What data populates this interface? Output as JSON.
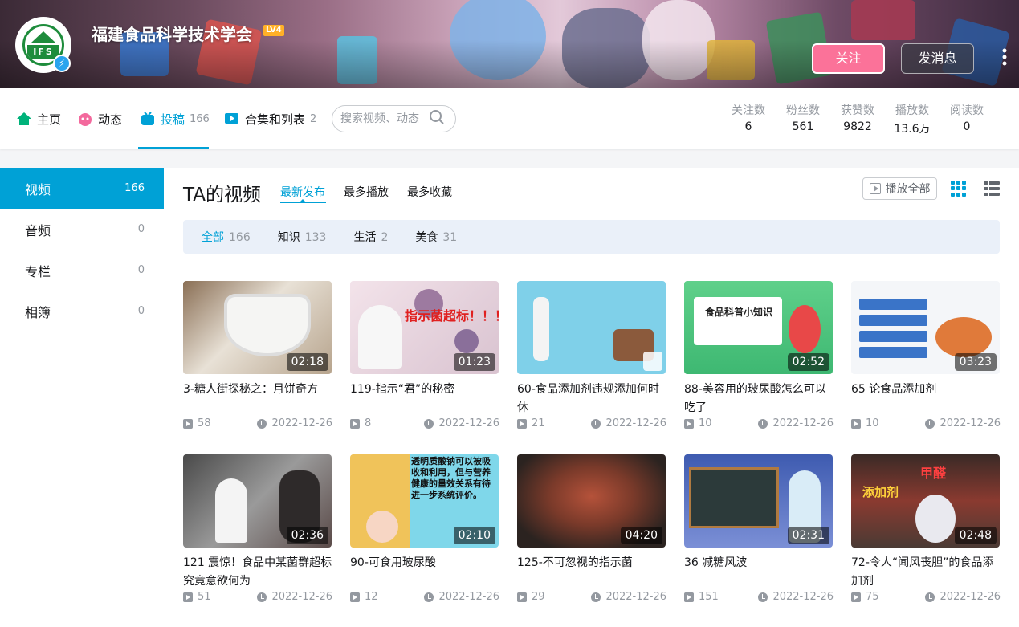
{
  "header": {
    "username": "福建食品科学技术学会",
    "level": "LV4",
    "avatar_text": "IFS",
    "follow_label": "关注",
    "message_label": "发消息",
    "more_label": "⋮"
  },
  "nav": {
    "items": [
      {
        "label": "主页",
        "count": ""
      },
      {
        "label": "动态",
        "count": ""
      },
      {
        "label": "投稿",
        "count": "166"
      },
      {
        "label": "合集和列表",
        "count": "2"
      }
    ],
    "search_placeholder": "搜索视频、动态"
  },
  "stats": [
    {
      "label": "关注数",
      "value": "6"
    },
    {
      "label": "粉丝数",
      "value": "561"
    },
    {
      "label": "获赞数",
      "value": "9822"
    },
    {
      "label": "播放数",
      "value": "13.6万"
    },
    {
      "label": "阅读数",
      "value": "0"
    }
  ],
  "sidebar": {
    "items": [
      {
        "label": "视频",
        "count": "166"
      },
      {
        "label": "音频",
        "count": "0"
      },
      {
        "label": "专栏",
        "count": "0"
      },
      {
        "label": "相簿",
        "count": "0"
      }
    ]
  },
  "main": {
    "title": "TA的视频",
    "sort": [
      "最新发布",
      "最多播放",
      "最多收藏"
    ],
    "play_all": "播放全部",
    "filters": [
      {
        "label": "全部",
        "count": "166"
      },
      {
        "label": "知识",
        "count": "133"
      },
      {
        "label": "生活",
        "count": "2"
      },
      {
        "label": "美食",
        "count": "31"
      }
    ]
  },
  "videos": [
    {
      "title": "3-糖人街探秘之：月饼奇方",
      "duration": "02:18",
      "plays": "58",
      "date": "2022-12-26"
    },
    {
      "title": "119-指示“君”的秘密",
      "duration": "01:23",
      "plays": "8",
      "date": "2022-12-26"
    },
    {
      "title": "60-食品添加剂违规添加何时休",
      "duration": "",
      "plays": "21",
      "date": "2022-12-26"
    },
    {
      "title": "88-美容用的玻尿酸怎么可以吃了",
      "duration": "02:52",
      "plays": "10",
      "date": "2022-12-26"
    },
    {
      "title": "65 论食品添加剂",
      "duration": "03:23",
      "plays": "10",
      "date": "2022-12-26"
    },
    {
      "title": "121 震惊！食品中某菌群超标究竟意欲何为",
      "duration": "02:36",
      "plays": "51",
      "date": "2022-12-26"
    },
    {
      "title": "90-可食用玻尿酸",
      "duration": "02:10",
      "plays": "12",
      "date": "2022-12-26"
    },
    {
      "title": "125-不可忽视的指示菌",
      "duration": "04:20",
      "plays": "29",
      "date": "2022-12-26"
    },
    {
      "title": "36 减糖风波",
      "duration": "02:31",
      "plays": "151",
      "date": "2022-12-26"
    },
    {
      "title": "72-令人“闻风丧胆”的食品添加剂",
      "duration": "02:48",
      "plays": "75",
      "date": "2022-12-26"
    }
  ],
  "thumb_text": {
    "t1_overlay": "指示菌超标！！！",
    "t4_overlay": "食品科普小知识",
    "t7_overlay": "透明质酸钠可以被吸收和利用，但与营养健康的量效关系有待进一步系统评价。",
    "t10_overlay_a": "甲醛",
    "t10_overlay_b": "添加剂"
  },
  "colors": {
    "accent": "#00a1d6",
    "follow": "#fb7299",
    "level_badge": "#ffb027"
  }
}
